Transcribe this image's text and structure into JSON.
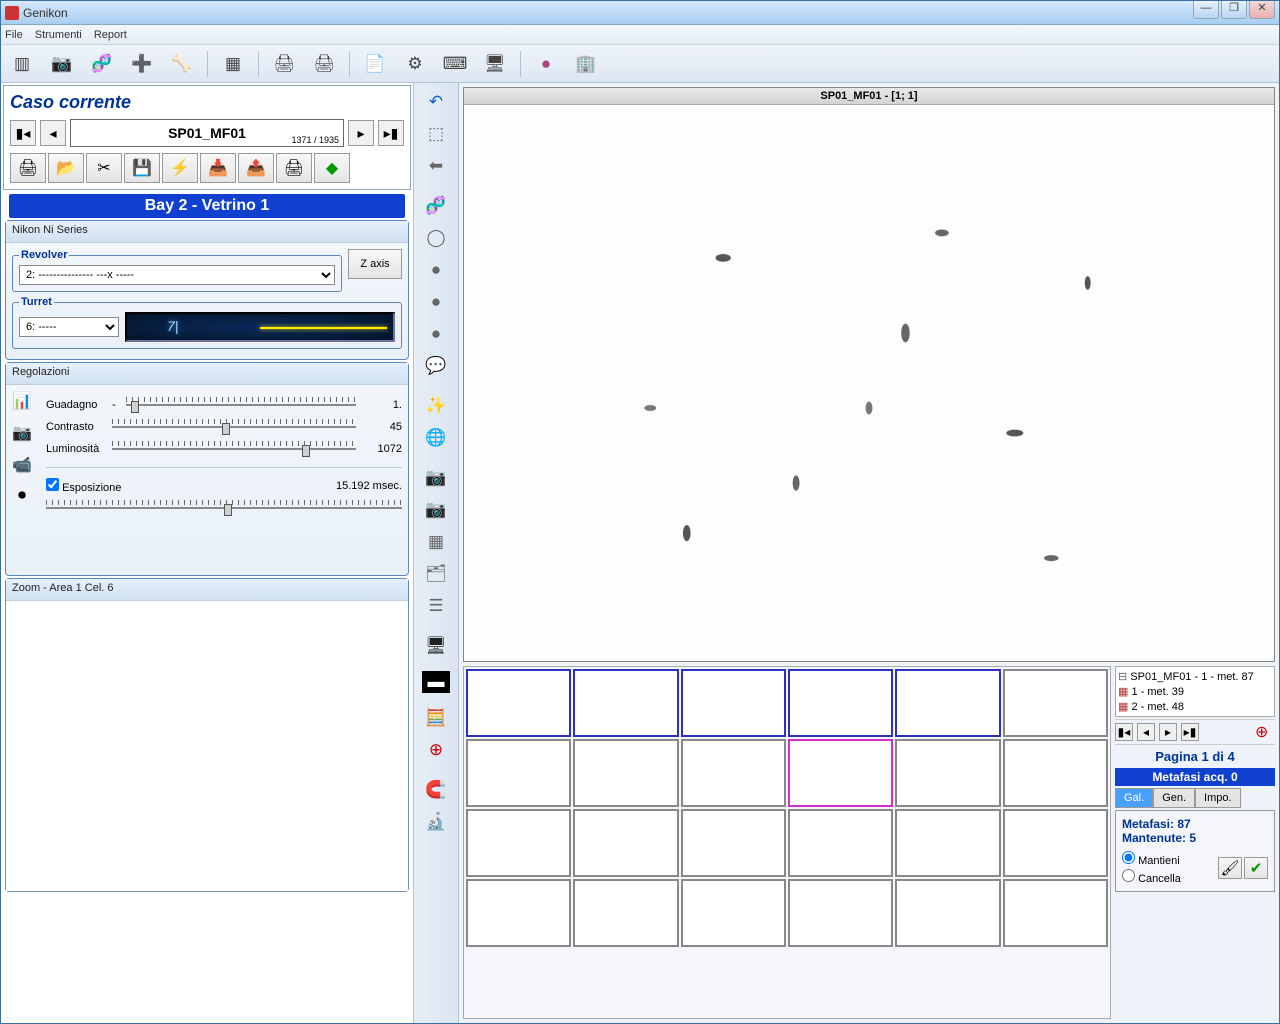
{
  "window": {
    "title": "Genikon"
  },
  "menu": [
    "File",
    "Strumenti",
    "Report"
  ],
  "left": {
    "caseTitle": "Caso corrente",
    "caseName": "SP01_MF01",
    "caseCount": "1371 / 1935",
    "bayTitle": "Bay 2 - Vetrino 1"
  },
  "nikon": {
    "panelTitle": "Nikon Ni Series",
    "revolverLegend": "Revolver",
    "revolverValue": "2: --------------- ---x -----",
    "zaxis": "Z axis",
    "turretLegend": "Turret",
    "turretValue": "6: -----"
  },
  "reg": {
    "title": "Regolazioni",
    "gainLabel": "Guadagno",
    "gainVal": "1.",
    "contrastLabel": "Contrasto",
    "contrastVal": "45",
    "brightLabel": "Luminosità",
    "brightVal": "1072",
    "expoLabel": "Esposizione",
    "expoVal": "15.192 msec."
  },
  "zoom": {
    "title": "Zoom - Area 1 Cel. 6"
  },
  "viewer": {
    "title": "SP01_MF01 - [1; 1]"
  },
  "tree": {
    "root": "SP01_MF01 - 1 - met. 87",
    "c1": "1 - met. 39",
    "c2": "2 - met. 48"
  },
  "pager": {
    "label": "Pagina 1 di 4",
    "acq": "Metafasi acq. 0"
  },
  "tabs": [
    "Gal.",
    "Gen.",
    "Impo."
  ],
  "info": {
    "metafasi": "Metafasi: 87",
    "mantenute": "Mantenute: 5",
    "optKeep": "Mantieni",
    "optDel": "Cancella"
  }
}
